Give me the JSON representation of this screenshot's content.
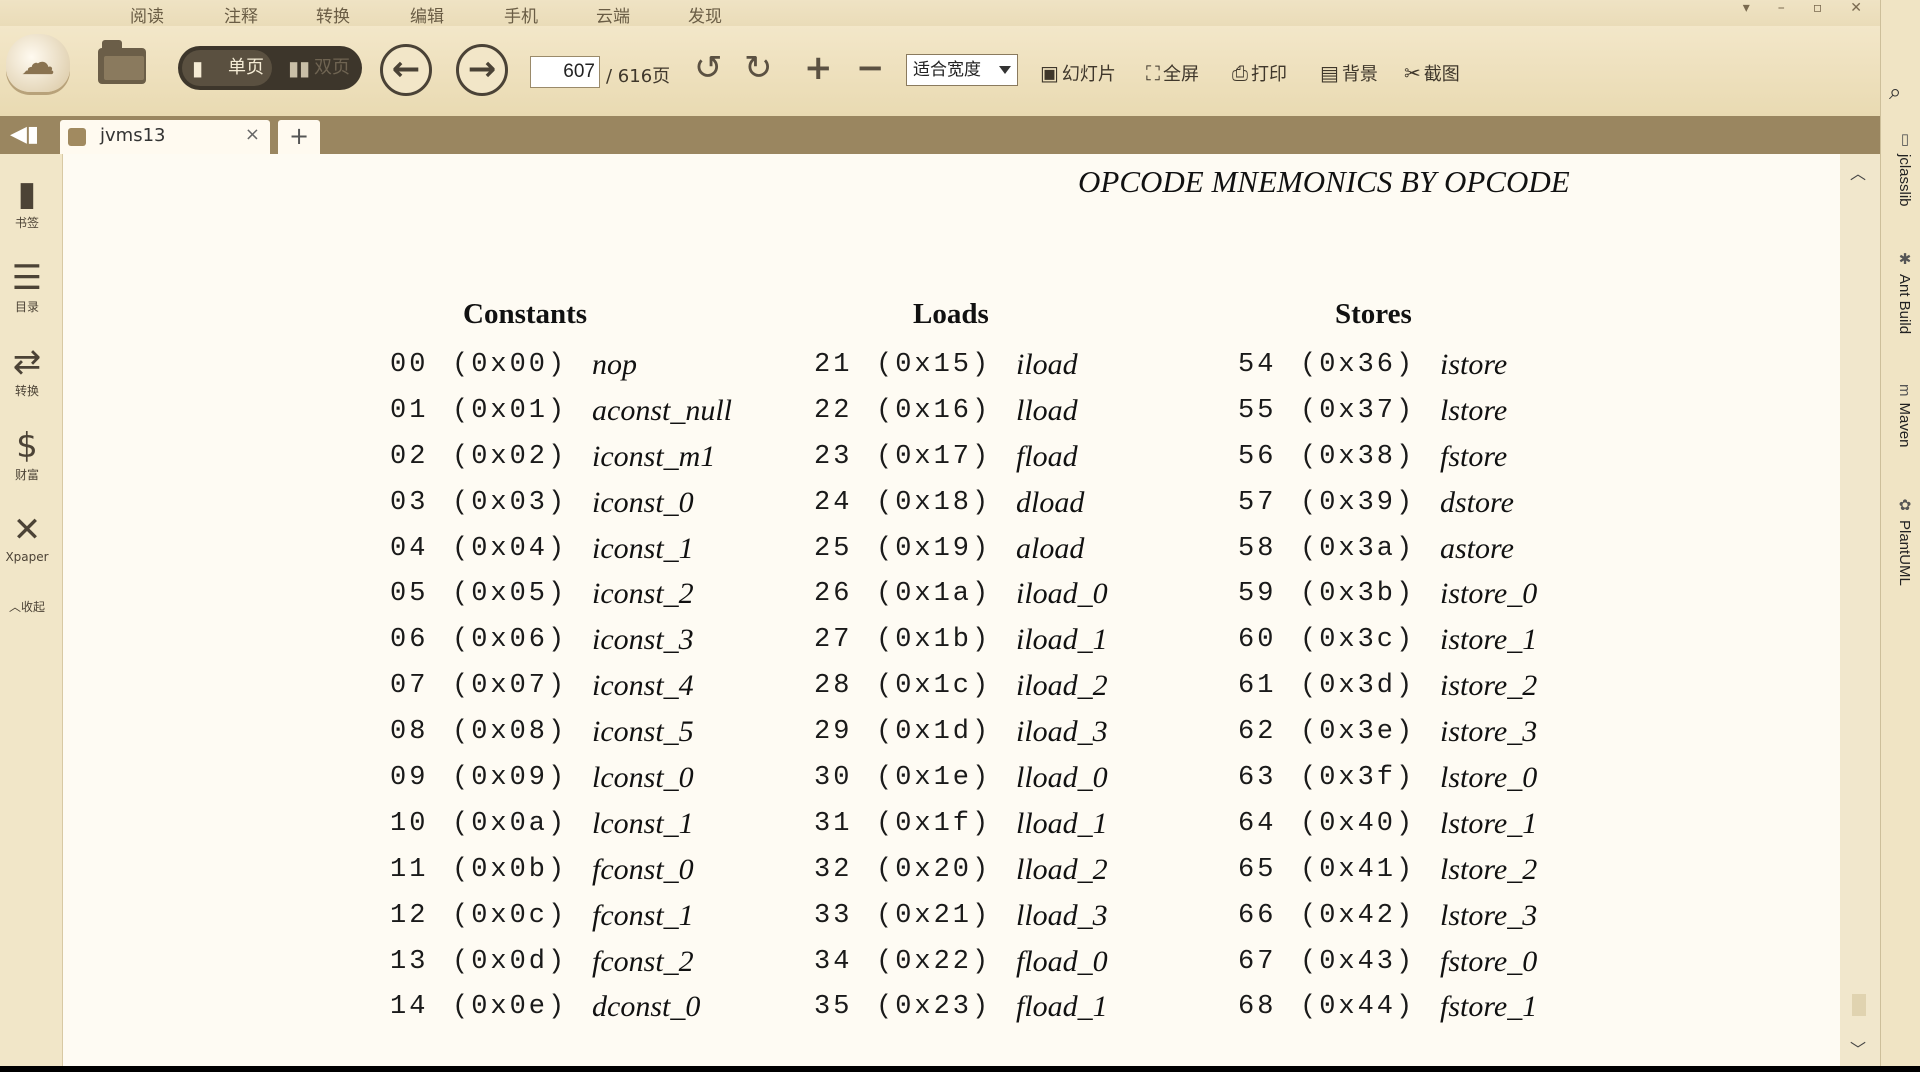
{
  "menu": [
    "阅读",
    "注释",
    "转换",
    "编辑",
    "手机",
    "云端",
    "发现"
  ],
  "toolbar": {
    "single_page": "单页",
    "double_page": "双页",
    "page_current": "607",
    "page_total": "/ 616页",
    "zoom": "适合宽度",
    "slideshow": "幻灯片",
    "fullscreen": "全屏",
    "print": "打印",
    "background": "背景",
    "screenshot": "截图"
  },
  "tab": {
    "label": "jvms13",
    "close": "×",
    "new": "+"
  },
  "left_sidebar": [
    {
      "label": "书签",
      "icon": "bookmark-icon"
    },
    {
      "label": "目录",
      "icon": "toc-icon"
    },
    {
      "label": "转换",
      "icon": "convert-icon"
    },
    {
      "label": "财富",
      "icon": "wealth-icon"
    },
    {
      "label": "Xpaper",
      "icon": "xpaper-icon"
    },
    {
      "label": "收起",
      "icon": "collapse-icon"
    }
  ],
  "right_sidebar": [
    "jclasslib",
    "Ant Build",
    "Maven",
    "PlantUML"
  ],
  "page": {
    "heading": "OPCODE MNEMONICS BY OPCODE",
    "columns": [
      {
        "title": "Constants",
        "rows": [
          [
            "00",
            "(0x00)",
            "nop"
          ],
          [
            "01",
            "(0x01)",
            "aconst_null"
          ],
          [
            "02",
            "(0x02)",
            "iconst_m1"
          ],
          [
            "03",
            "(0x03)",
            "iconst_0"
          ],
          [
            "04",
            "(0x04)",
            "iconst_1"
          ],
          [
            "05",
            "(0x05)",
            "iconst_2"
          ],
          [
            "06",
            "(0x06)",
            "iconst_3"
          ],
          [
            "07",
            "(0x07)",
            "iconst_4"
          ],
          [
            "08",
            "(0x08)",
            "iconst_5"
          ],
          [
            "09",
            "(0x09)",
            "lconst_0"
          ],
          [
            "10",
            "(0x0a)",
            "lconst_1"
          ],
          [
            "11",
            "(0x0b)",
            "fconst_0"
          ],
          [
            "12",
            "(0x0c)",
            "fconst_1"
          ],
          [
            "13",
            "(0x0d)",
            "fconst_2"
          ],
          [
            "14",
            "(0x0e)",
            "dconst_0"
          ]
        ]
      },
      {
        "title": "Loads",
        "rows": [
          [
            "21",
            "(0x15)",
            "iload"
          ],
          [
            "22",
            "(0x16)",
            "lload"
          ],
          [
            "23",
            "(0x17)",
            "fload"
          ],
          [
            "24",
            "(0x18)",
            "dload"
          ],
          [
            "25",
            "(0x19)",
            "aload"
          ],
          [
            "26",
            "(0x1a)",
            "iload_0"
          ],
          [
            "27",
            "(0x1b)",
            "iload_1"
          ],
          [
            "28",
            "(0x1c)",
            "iload_2"
          ],
          [
            "29",
            "(0x1d)",
            "iload_3"
          ],
          [
            "30",
            "(0x1e)",
            "lload_0"
          ],
          [
            "31",
            "(0x1f)",
            "lload_1"
          ],
          [
            "32",
            "(0x20)",
            "lload_2"
          ],
          [
            "33",
            "(0x21)",
            "lload_3"
          ],
          [
            "34",
            "(0x22)",
            "fload_0"
          ],
          [
            "35",
            "(0x23)",
            "fload_1"
          ]
        ]
      },
      {
        "title": "Stores",
        "rows": [
          [
            "54",
            "(0x36)",
            "istore"
          ],
          [
            "55",
            "(0x37)",
            "lstore"
          ],
          [
            "56",
            "(0x38)",
            "fstore"
          ],
          [
            "57",
            "(0x39)",
            "dstore"
          ],
          [
            "58",
            "(0x3a)",
            "astore"
          ],
          [
            "59",
            "(0x3b)",
            "istore_0"
          ],
          [
            "60",
            "(0x3c)",
            "istore_1"
          ],
          [
            "61",
            "(0x3d)",
            "istore_2"
          ],
          [
            "62",
            "(0x3e)",
            "istore_3"
          ],
          [
            "63",
            "(0x3f)",
            "lstore_0"
          ],
          [
            "64",
            "(0x40)",
            "lstore_1"
          ],
          [
            "65",
            "(0x41)",
            "lstore_2"
          ],
          [
            "66",
            "(0x42)",
            "lstore_3"
          ],
          [
            "67",
            "(0x43)",
            "fstore_0"
          ],
          [
            "68",
            "(0x44)",
            "fstore_1"
          ]
        ]
      }
    ]
  },
  "colors": {
    "chrome": "#f3ead3",
    "tabbar": "#9a8660",
    "page": "#fefbf3"
  }
}
